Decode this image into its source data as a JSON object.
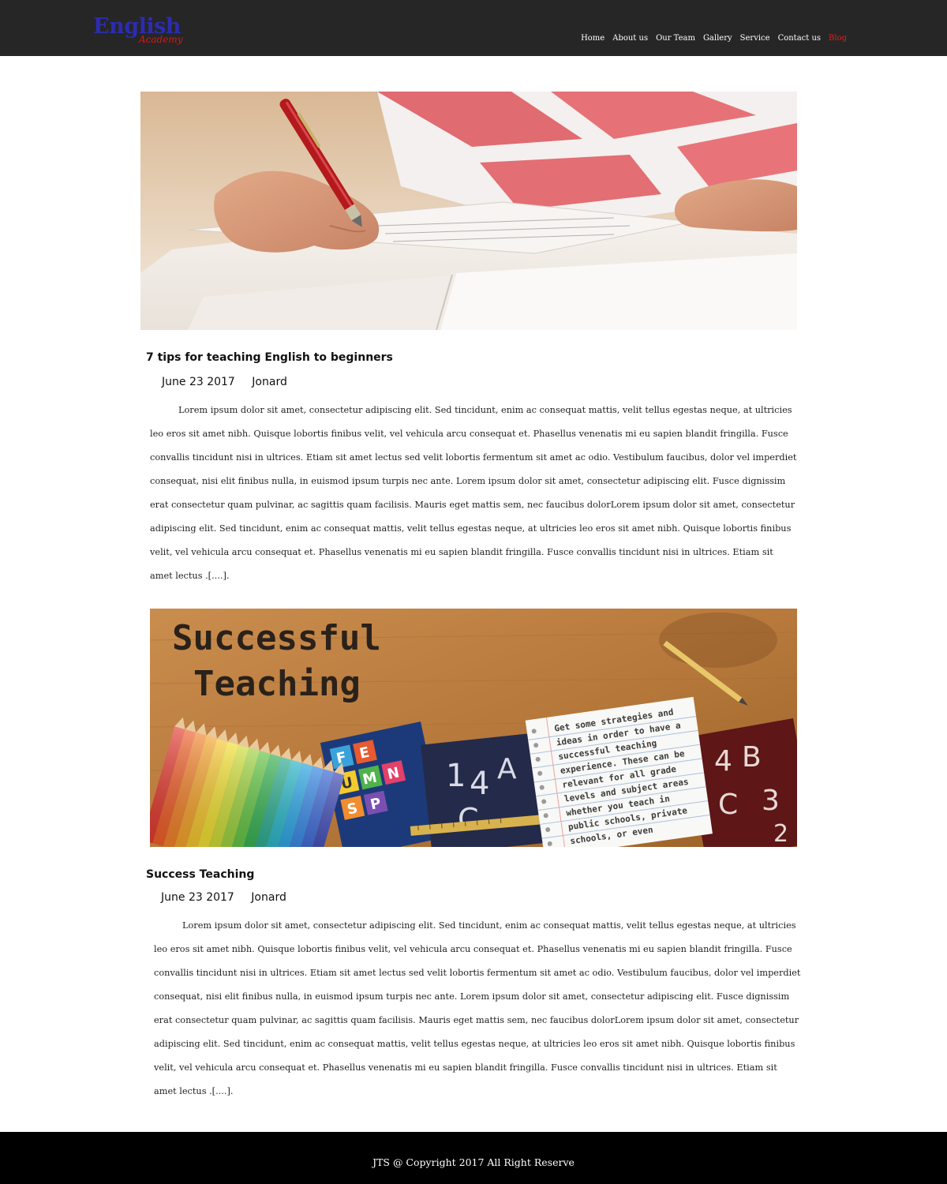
{
  "brand": {
    "name": "English",
    "tagline": "Academy"
  },
  "nav": {
    "items": [
      {
        "label": "Home"
      },
      {
        "label": "About us"
      },
      {
        "label": "Our Team"
      },
      {
        "label": "Gallery"
      },
      {
        "label": "Service"
      },
      {
        "label": "Contact us"
      },
      {
        "label": "Blog",
        "active": true
      }
    ]
  },
  "posts": [
    {
      "title": "7 tips for teaching English to beginners",
      "date": "June 23 2017",
      "author": "Jonard",
      "body": "Lorem ipsum dolor sit amet, consectetur adipiscing elit. Sed tincidunt, enim ac consequat mattis, velit tellus egestas neque, at ultricies leo eros sit amet nibh. Quisque lobortis finibus velit, vel vehicula arcu consequat et. Phasellus venenatis mi eu sapien blandit fringilla. Fusce convallis tincidunt nisi in ultrices. Etiam sit amet lectus sed velit lobortis fermentum sit amet ac odio. Vestibulum faucibus, dolor vel imperdiet consequat, nisi elit finibus nulla, in euismod ipsum turpis nec ante. Lorem ipsum dolor sit amet, consectetur adipiscing elit. Fusce dignissim erat consectetur quam pulvinar, ac sagittis quam facilisis. Mauris eget mattis sem, nec faucibus dolorLorem ipsum dolor sit amet, consectetur adipiscing elit. Sed tincidunt, enim ac consequat mattis, velit tellus egestas neque, at ultricies leo eros sit amet nibh. Quisque lobortis finibus velit, vel vehicula arcu consequat et. Phasellus venenatis mi eu sapien blandit fringilla. Fusce convallis tincidunt nisi in ultrices. Etiam sit amet lectus .[....].",
      "image_alt": "writing-photo"
    },
    {
      "title": "Success Teaching",
      "date": "June 23 2017",
      "author": "Jonard",
      "body": "Lorem ipsum dolor sit amet, consectetur adipiscing elit. Sed tincidunt, enim ac consequat mattis, velit tellus egestas neque, at ultricies leo eros sit amet nibh. Quisque lobortis finibus velit, vel vehicula arcu consequat et. Phasellus venenatis mi eu sapien blandit fringilla. Fusce convallis tincidunt nisi in ultrices. Etiam sit amet lectus sed velit lobortis fermentum sit amet ac odio. Vestibulum faucibus, dolor vel imperdiet consequat, nisi elit finibus nulla, in euismod ipsum turpis nec ante. Lorem ipsum dolor sit amet, consectetur adipiscing elit. Fusce dignissim erat consectetur quam pulvinar, ac sagittis quam facilisis. Mauris eget mattis sem, nec faucibus dolorLorem ipsum dolor sit amet, consectetur adipiscing elit. Sed tincidunt, enim ac consequat mattis, velit tellus egestas neque, at ultricies leo eros sit amet nibh. Quisque lobortis finibus velit, vel vehicula arcu consequat et. Phasellus venenatis mi eu sapien blandit fringilla. Fusce convallis tincidunt nisi in ultrices. Etiam sit amet lectus .[....].",
      "image": {
        "heading_line1": "Successful",
        "heading_line2": "Teaching",
        "note": "Get some strategies and ideas in order to have a successful teaching experience. These can be relevant for all grade levels and subject areas whether you teach in public schools, private schools, or even homeschool."
      }
    }
  ],
  "footer": {
    "text": "JTS @  Copyright  2017 All Right Reserve"
  },
  "colors": {
    "header_bg": "#262626",
    "brand_blue": "#2c2cb0",
    "brand_red": "#d11a1a",
    "nav_active": "#e01d1d",
    "footer_bg": "#000000"
  }
}
